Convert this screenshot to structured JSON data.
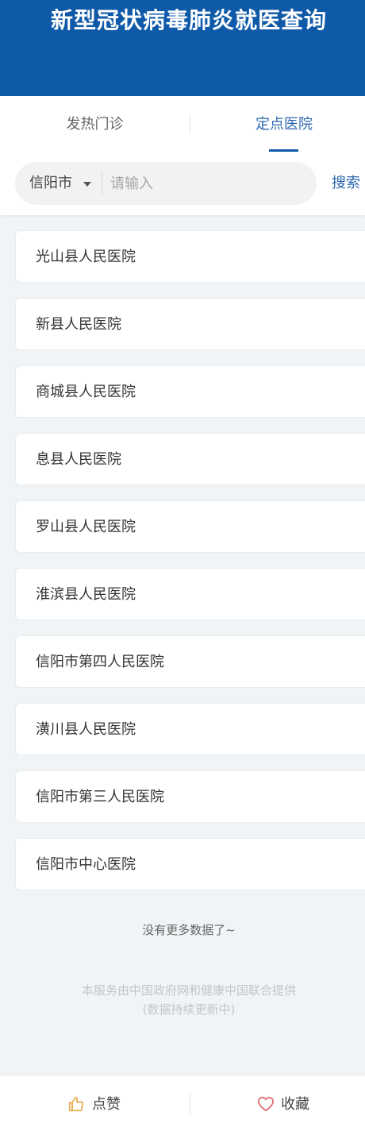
{
  "header": {
    "title": "新型冠状病毒肺炎就医查询"
  },
  "tabs": [
    {
      "label": "发热门诊",
      "active": false
    },
    {
      "label": "定点医院",
      "active": true
    }
  ],
  "search": {
    "city": "信阳市",
    "placeholder": "请输入",
    "button": "搜索"
  },
  "hospitals": [
    "光山县人民医院",
    "新县人民医院",
    "商城县人民医院",
    "息县人民医院",
    "罗山县人民医院",
    "淮滨县人民医院",
    "信阳市第四人民医院",
    "潢川县人民医院",
    "信阳市第三人民医院",
    "信阳市中心医院"
  ],
  "footer": {
    "no_more": "没有更多数据了~",
    "credit_line1": "本服务由中国政府网和健康中国联合提供",
    "credit_line2": "(数据持续更新中)"
  },
  "bottom_bar": {
    "like_label": "点赞",
    "like_icon": "thumbs-up-icon",
    "favorite_label": "收藏",
    "favorite_icon": "heart-icon"
  },
  "colors": {
    "brand": "#0f5aa8",
    "active_tab": "#2b66b0",
    "like_icon": "#e6a94a",
    "favorite_icon": "#e07078"
  }
}
